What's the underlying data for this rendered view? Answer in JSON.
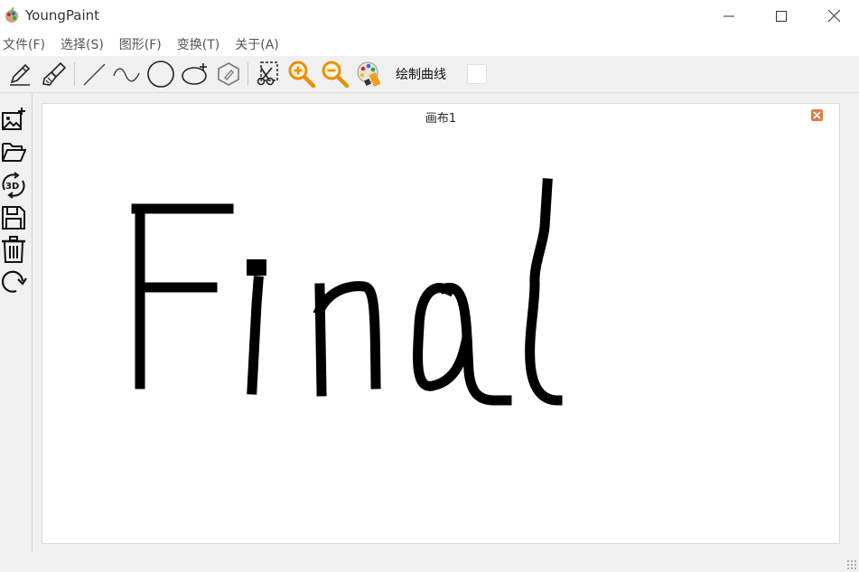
{
  "window": {
    "title": "YoungPaint"
  },
  "menu": [
    {
      "label": "文件(F)"
    },
    {
      "label": "选择(S)"
    },
    {
      "label": "图形(F)"
    },
    {
      "label": "变换(T)"
    },
    {
      "label": "关于(A)"
    }
  ],
  "toolbar": {
    "tools": [
      "pencil-icon",
      "brush-icon",
      "line-icon",
      "curve-icon",
      "circle-icon",
      "lasso-icon",
      "eraser-icon",
      "cut-icon",
      "zoom-in-icon",
      "zoom-out-icon",
      "palette-icon"
    ],
    "status_text": "绘制曲线",
    "current_color": "#ffffff"
  },
  "side_tools": [
    "new-image-icon",
    "open-folder-icon",
    "rotate-3d-icon",
    "save-icon",
    "delete-icon",
    "redo-icon"
  ],
  "document": {
    "tab_title": "画布1"
  },
  "colors": {
    "accent_zoom": "#e8900c",
    "close_tab": "#e07b4a",
    "ink": "#000000"
  }
}
